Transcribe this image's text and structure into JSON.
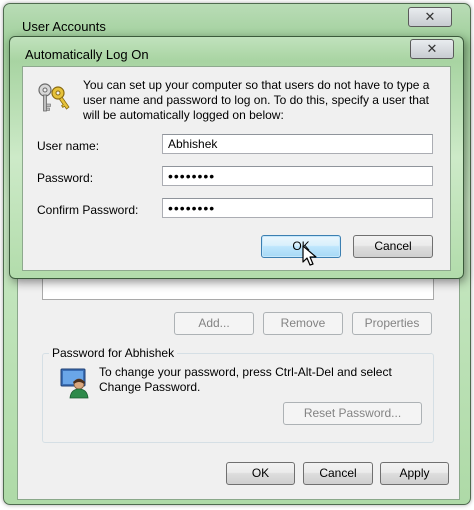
{
  "back_window": {
    "title": "User Accounts",
    "buttons": {
      "add": "Add...",
      "remove": "Remove",
      "properties": "Properties"
    },
    "password_group": {
      "label": "Password for Abhishek",
      "text": "To change your password, press Ctrl-Alt-Del and select Change Password.",
      "reset_button": "Reset Password..."
    },
    "footer": {
      "ok": "OK",
      "cancel": "Cancel",
      "apply": "Apply"
    }
  },
  "dialog": {
    "title": "Automatically Log On",
    "intro": "You can set up your computer so that users do not have to type a user name and password to log on. To do this, specify a user that will be automatically logged on below:",
    "user_name_label": "User name:",
    "user_name_value": "Abhishek",
    "password_label": "Password:",
    "password_value": "••••••••",
    "confirm_label": "Confirm Password:",
    "confirm_value": "••••••••",
    "ok": "OK",
    "cancel": "Cancel"
  },
  "icons": {
    "close": "close-icon",
    "keys": "keys-icon",
    "user": "user-icon",
    "cursor": "mouse-cursor-icon"
  }
}
